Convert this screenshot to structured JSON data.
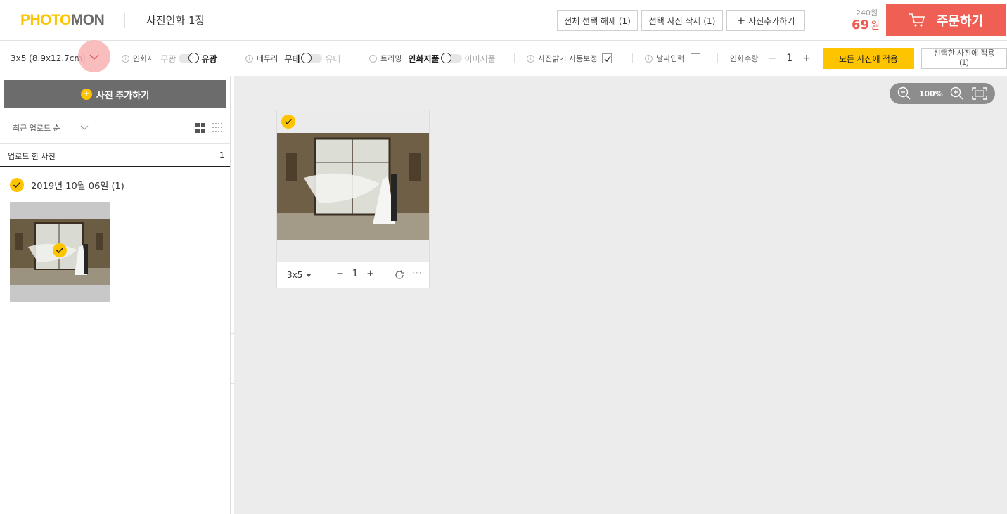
{
  "header": {
    "logo_photo": "PHOTO",
    "logo_mon": "MON",
    "title": "사진인화 1장",
    "btn_deselect_all": "전체 선택 해제 (1)",
    "btn_delete_selected": "선택 사진 삭제 (1)",
    "btn_add_photo": "사진추가하기",
    "price_old": "240원",
    "price_new": "69",
    "price_unit": "원",
    "order_label": "주문하기"
  },
  "toolbar": {
    "size_value": "3x5 (8.9x12.7cm)",
    "paper_label": "인화지",
    "paper_opt_matte": "무광",
    "paper_opt_gloss": "유광",
    "border_label": "테두리",
    "border_opt_none": "무테",
    "border_opt_yes": "유테",
    "trim_label": "트리밍",
    "trim_opt_full": "인화지풀",
    "trim_opt_image": "이미지풀",
    "auto_label": "사진밝기 자동보정",
    "date_label": "날짜입력",
    "qty_label": "인화수량",
    "qty_value": "1",
    "apply_all": "모든 사진에 적용",
    "apply_selected_line1": "선택한 사진에 적용",
    "apply_selected_line2": "(1)"
  },
  "sidebar": {
    "add_photo": "사진 추가하기",
    "sort_label": "최근 업로드 순",
    "tab_uploaded": "업로드 한 사진",
    "tab_count": "1",
    "date_group": "2019년 10월 06일 (1)"
  },
  "main": {
    "zoom_level": "100%",
    "card_size": "3x5",
    "card_qty": "1"
  },
  "colors": {
    "accent_yellow": "#ffc400",
    "order_red": "#ef5f53",
    "price_red": "#ee5a52"
  }
}
